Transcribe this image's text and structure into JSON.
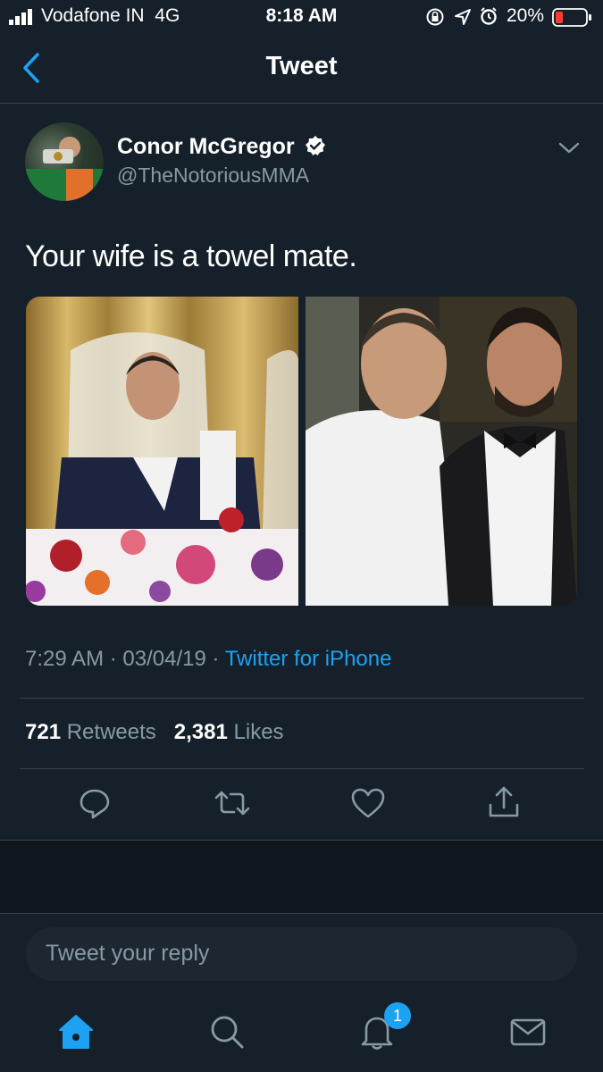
{
  "status_bar": {
    "carrier": "Vodafone IN",
    "network": "4G",
    "time": "8:18 AM",
    "battery": "20%"
  },
  "nav": {
    "title": "Tweet"
  },
  "tweet": {
    "display_name": "Conor McGregor",
    "handle": "@TheNotoriousMMA",
    "text": "Your wife is a towel mate.",
    "timestamp": "7:29 AM · 03/04/19 ·",
    "source": "Twitter for iPhone",
    "retweets_count": "721",
    "retweets_label": "Retweets",
    "likes_count": "2,381",
    "likes_label": "Likes"
  },
  "reply": {
    "placeholder": "Tweet your reply"
  },
  "tabbar": {
    "notifications_badge": "1"
  },
  "colors": {
    "background": "#15202b",
    "accent": "#1da1f2",
    "secondary_text": "#8899a6",
    "divider": "#38444d"
  },
  "icons": [
    "signal-icon",
    "orientation-lock-icon",
    "location-icon",
    "alarm-icon",
    "battery-icon",
    "back-chevron-icon",
    "verified-badge-icon",
    "chevron-down-icon",
    "reply-icon",
    "retweet-icon",
    "like-icon",
    "share-icon",
    "home-icon",
    "search-icon",
    "notifications-icon",
    "messages-icon"
  ]
}
